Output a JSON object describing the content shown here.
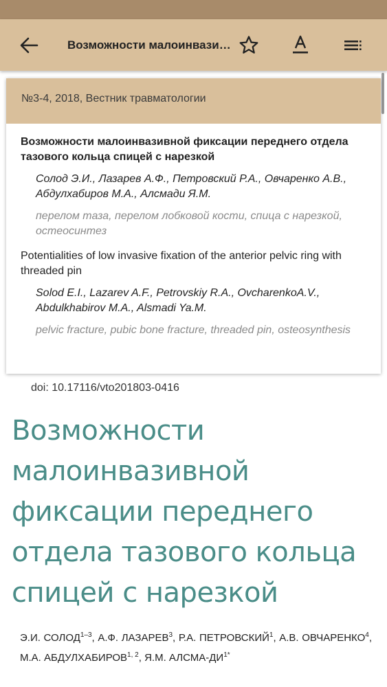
{
  "appbar": {
    "title": "Возможности малоинвазивной фиксации переднего отдела тазового кольца спицей с нарезкой"
  },
  "card": {
    "source": "№3-4, 2018, Вестник травматологии",
    "ru_title": "Возможности малоинвазивной фиксации переднего отдела тазового кольца спицей с нарезкой",
    "ru_authors": "Солод Э.И., Лазарев А.Ф., Петровский Р.А., Овчаренко А.В., Абдулхабиров М.А., Алсмади Я.М.",
    "ru_keywords": "перелом таза, перелом лобковой кости, спица с нарезкой, остеосинтез",
    "en_title": "Potentialities of low invasive fixation of the anterior pelvic ring with threaded pin",
    "en_authors": "Solod E.I., Lazarev A.F., Petrovskiy R.A., OvcharenkoA.V., Abdulkhabirov M.A., Alsmadi Ya.M.",
    "en_keywords": "pelvic fracture, pubic bone fracture, threaded pin, osteosynthesis"
  },
  "doi": "doi: 10.17116/vto201803-0416",
  "article": {
    "title": "Возможности малоинвазивной фиксации переднего отдела тазового кольца спицей с нарезкой",
    "authors": [
      {
        "name": "Э.И. СОЛОД",
        "sup": "1–3"
      },
      {
        "name": "А.Ф. ЛАЗАРЕВ",
        "sup": "3"
      },
      {
        "name": "Р.А. ПЕТРОВСКИЙ",
        "sup": "1"
      },
      {
        "name": "А.В. ОВЧАРЕНКО",
        "sup": "4"
      },
      {
        "name": "М.А. АБДУЛХАБИРОВ",
        "sup": "1, 2"
      },
      {
        "name": "Я.М. АЛСМА-ДИ",
        "sup": "1*"
      }
    ]
  },
  "icons": {
    "back": "arrow-left-icon",
    "favorite": "star-outline-icon",
    "font": "text-format-icon",
    "contents": "list-menu-icon"
  },
  "colors": {
    "statusbar": "#a88b6a",
    "appbar": "#d9bf9b",
    "title_accent": "#4a8d88",
    "keywords": "#8a8a8a"
  }
}
